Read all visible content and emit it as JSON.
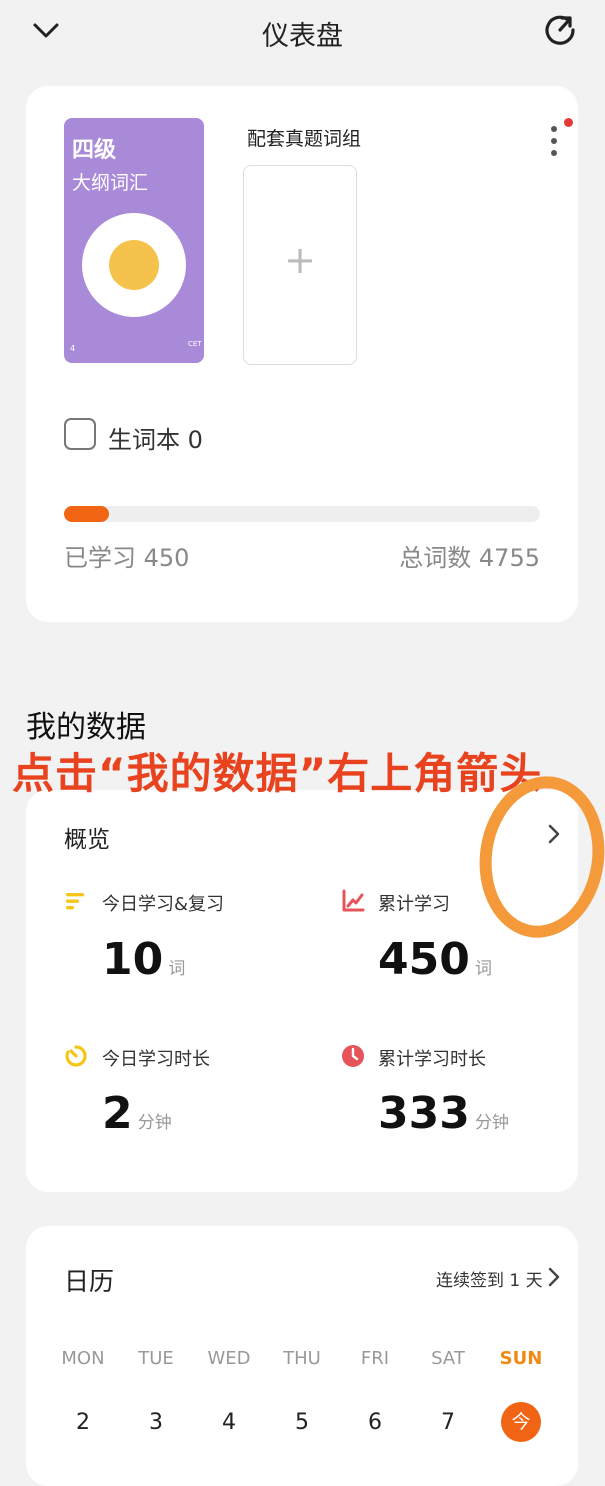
{
  "header": {
    "title": "仪表盘",
    "back_icon": "chevron-down-icon",
    "refresh_icon": "refresh-icon"
  },
  "book_card": {
    "book_title_line1": "四级",
    "book_title_line2": "大纲词汇",
    "book_corner_mark_left": "4",
    "book_corner_mark_right": "CET",
    "paired_group_label": "配套真题词组",
    "add_symbol": "+",
    "more_icon": "more-vertical-icon",
    "vocab_notebook_label": "生词本 0",
    "progress_fraction": 0.095,
    "learned_label": "已学习 450",
    "total_label": "总词数 4755"
  },
  "my_data": {
    "section_title": "我的数据",
    "annotation": "点击“我的数据”右上角箭头",
    "overview_title": "概览",
    "stats": [
      {
        "label": "今日学习&复习",
        "value": "10",
        "unit": "词",
        "icon": "list-icon",
        "color": "#f5c518"
      },
      {
        "label": "累计学习",
        "value": "450",
        "unit": "词",
        "icon": "chart-line-icon",
        "color": "#e5545a"
      },
      {
        "label": "今日学习时长",
        "value": "2",
        "unit": "分钟",
        "icon": "timer-icon",
        "color": "#f5c518"
      },
      {
        "label": "累计学习时长",
        "value": "333",
        "unit": "分钟",
        "icon": "clock-icon",
        "color": "#e5545a"
      }
    ]
  },
  "calendar": {
    "title": "日历",
    "streak_label": "连续签到 1 天",
    "weekdays": [
      "MON",
      "TUE",
      "WED",
      "THU",
      "FRI",
      "SAT",
      "SUN"
    ],
    "dates": [
      "2",
      "3",
      "4",
      "5",
      "6",
      "7"
    ],
    "today_label": "今"
  }
}
